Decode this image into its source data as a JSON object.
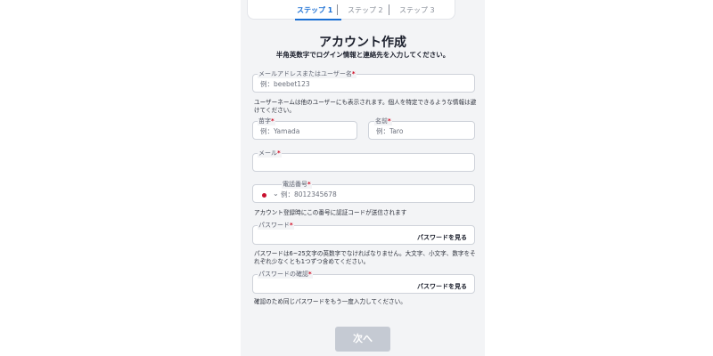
{
  "steps": [
    "ステップ 1",
    "ステップ 2",
    "ステップ 3"
  ],
  "title": "アカウント作成",
  "subtitle": "半角英数字でログイン情報と連絡先を入力してください。",
  "required_mark": "*",
  "username": {
    "label": "メールアドレスまたはユーザー名",
    "placeholder": "例：beebet123",
    "helper": "ユーザーネームは他のユーザーにも表示されます。個人を特定できるような情報は避けてください。"
  },
  "last_name": {
    "label": "苗字",
    "placeholder": "例：Yamada"
  },
  "first_name": {
    "label": "名前",
    "placeholder": "例：Taro"
  },
  "email": {
    "label": "メール",
    "value": ""
  },
  "phone": {
    "label": "電話番号",
    "placeholder": "例：8012345678",
    "country_flag": "japan-flag-icon",
    "helper": "アカウント登録時にこの番号に認証コードが送信されます"
  },
  "password": {
    "label": "パスワード",
    "show_label": "パスワードを見る",
    "helper": "パスワードは6~25文字の英数字でなければなりません。大文字、小文字、数字をそれぞれ少なくとも1つずつ含めてください。"
  },
  "password_confirm": {
    "label": "パスワードの確認",
    "show_label": "パスワードを見る",
    "helper": "確認のため同じパスワードをもう一度入力してください。"
  },
  "next_button": "次へ",
  "colors": {
    "accent": "#1a6fd4",
    "required": "#d0021b",
    "button_disabled": "#c5cad3",
    "panel_bg": "#f3f4f6"
  }
}
